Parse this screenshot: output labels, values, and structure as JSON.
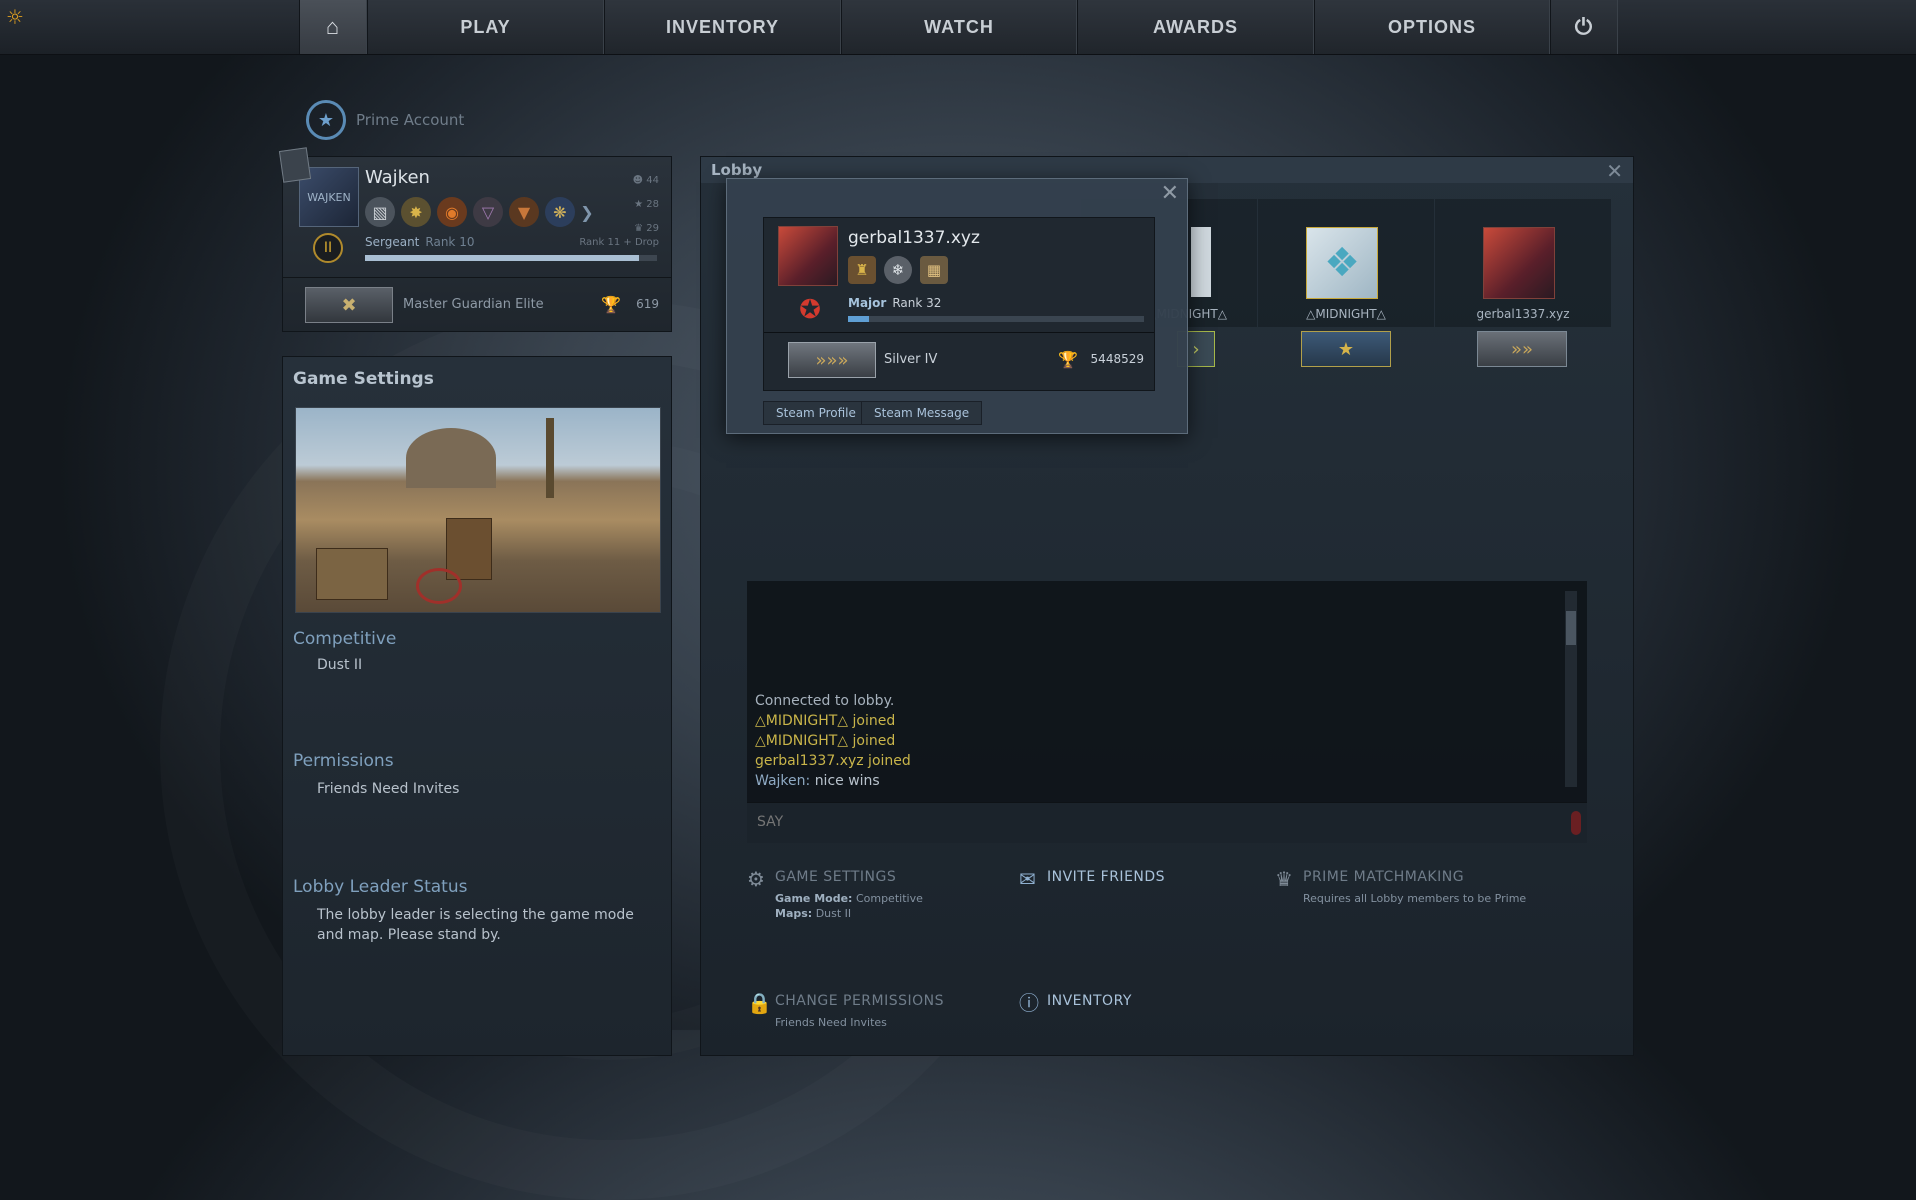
{
  "nav": {
    "home_icon": "home-icon",
    "items": [
      "PLAY",
      "INVENTORY",
      "WATCH",
      "AWARDS",
      "OPTIONS"
    ],
    "power_icon": "power-icon"
  },
  "prime": {
    "label": "Prime Account"
  },
  "profile": {
    "name": "Wajken",
    "avatar_text": "WAJKEN",
    "stats": [
      "44",
      "28",
      "29"
    ],
    "rank_title": "Sergeant",
    "rank_level": "Rank 10",
    "rank_drop": "Rank 11 + Drop",
    "xp_progress": 0.94,
    "skill_group": "Master Guardian Elite",
    "wins": "619"
  },
  "game_settings": {
    "title": "Game Settings",
    "mode_heading": "Competitive",
    "map": "Dust II",
    "permissions_heading": "Permissions",
    "permissions_value": "Friends Need Invites",
    "leader_heading": "Lobby Leader Status",
    "leader_value": "The lobby leader is selecting the game mode and map. Please stand by."
  },
  "lobby": {
    "title": "Lobby",
    "slots": [
      {
        "name": "△MIDNIGHT△"
      },
      {
        "name": "△MIDNIGHT△"
      },
      {
        "name": "gerbal1337.xyz"
      }
    ],
    "chat": [
      {
        "kind": "sys",
        "text": "Connected to lobby."
      },
      {
        "kind": "join",
        "text": "△MIDNIGHT△ joined"
      },
      {
        "kind": "join",
        "text": "△MIDNIGHT△ joined"
      },
      {
        "kind": "join",
        "text": "gerbal1337.xyz joined"
      },
      {
        "kind": "msg",
        "author": "Wajken:",
        "text": "nice wins"
      }
    ],
    "say_placeholder": "SAY",
    "actions": {
      "game_settings": {
        "label": "GAME SETTINGS",
        "mode_label": "Game Mode:",
        "mode_value": "Competitive",
        "maps_label": "Maps:",
        "maps_value": "Dust II"
      },
      "invite_friends": {
        "label": "INVITE FRIENDS"
      },
      "prime_matchmaking": {
        "label": "PRIME MATCHMAKING",
        "sub": "Requires all Lobby members to be Prime"
      },
      "change_permissions": {
        "label": "CHANGE PERMISSIONS",
        "sub": "Friends Need Invites"
      },
      "inventory": {
        "label": "INVENTORY"
      }
    }
  },
  "popup": {
    "name": "gerbal1337.xyz",
    "rank_title": "Major",
    "rank_level": "Rank 32",
    "xp_progress": 0.07,
    "skill_group": "Silver IV",
    "wins": "5448529",
    "btn_profile": "Steam Profile",
    "btn_message": "Steam Message"
  },
  "colors": {
    "accent_blue": "#7fa0bd",
    "join_yellow": "#c9b54a",
    "rank_red": "#d33a2e"
  }
}
